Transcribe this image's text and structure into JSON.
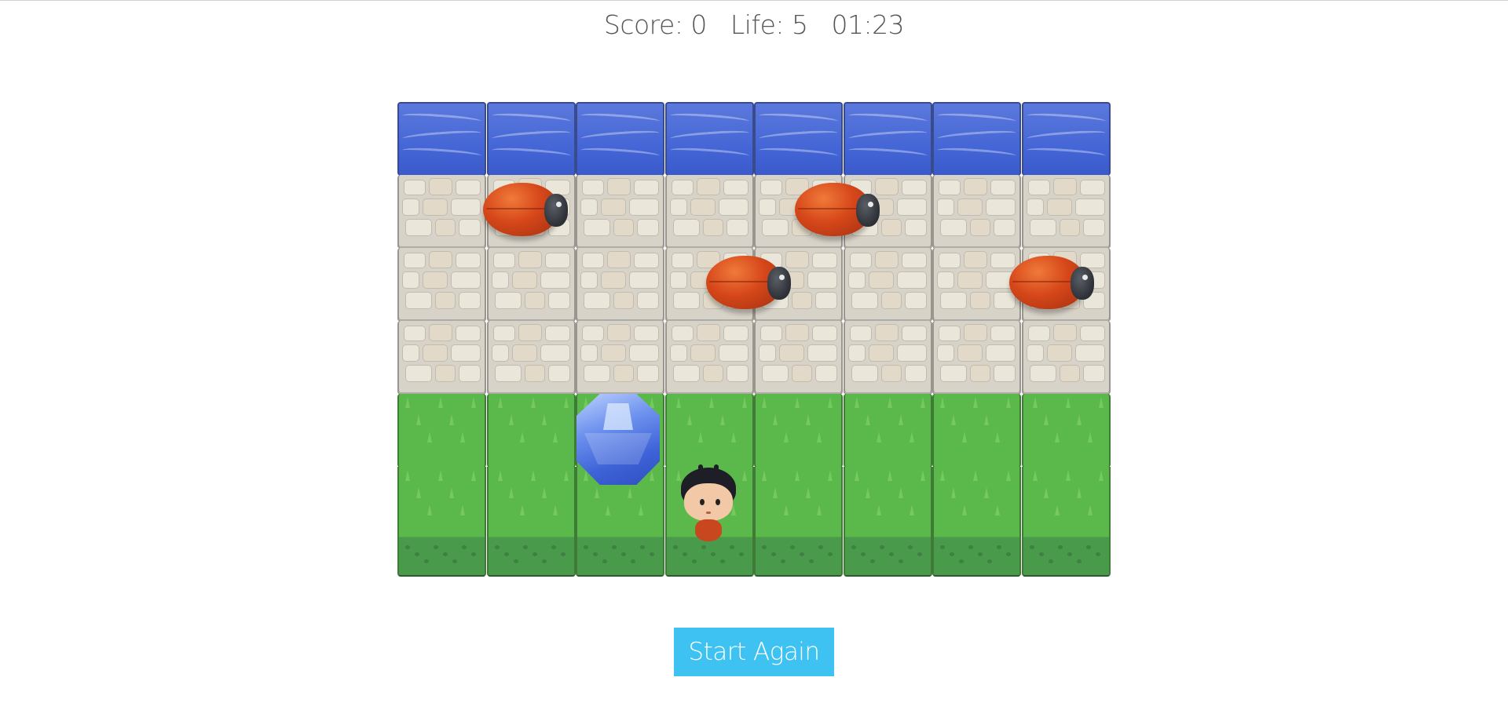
{
  "hud": {
    "score_label": "Score: 0",
    "life_label": "Life: 5",
    "timer": "01:23"
  },
  "board": {
    "columns": 8,
    "rows": [
      "water",
      "stone",
      "stone",
      "stone",
      "grass",
      "grass"
    ],
    "enemies": [
      {
        "row": 1,
        "col": 1.4
      },
      {
        "row": 1,
        "col": 4.9
      },
      {
        "row": 2,
        "col": 3.9
      },
      {
        "row": 2,
        "col": 7.3
      }
    ],
    "gem": {
      "row": 4,
      "col": 2,
      "color": "blue"
    },
    "player": {
      "row": 5,
      "col": 3
    }
  },
  "colors": {
    "accent": "#3ec2f2",
    "water": "#4566d6",
    "grass": "#5bb84a",
    "stone": "#d8d3c8"
  },
  "actions": {
    "restart_label": "Start Again"
  }
}
